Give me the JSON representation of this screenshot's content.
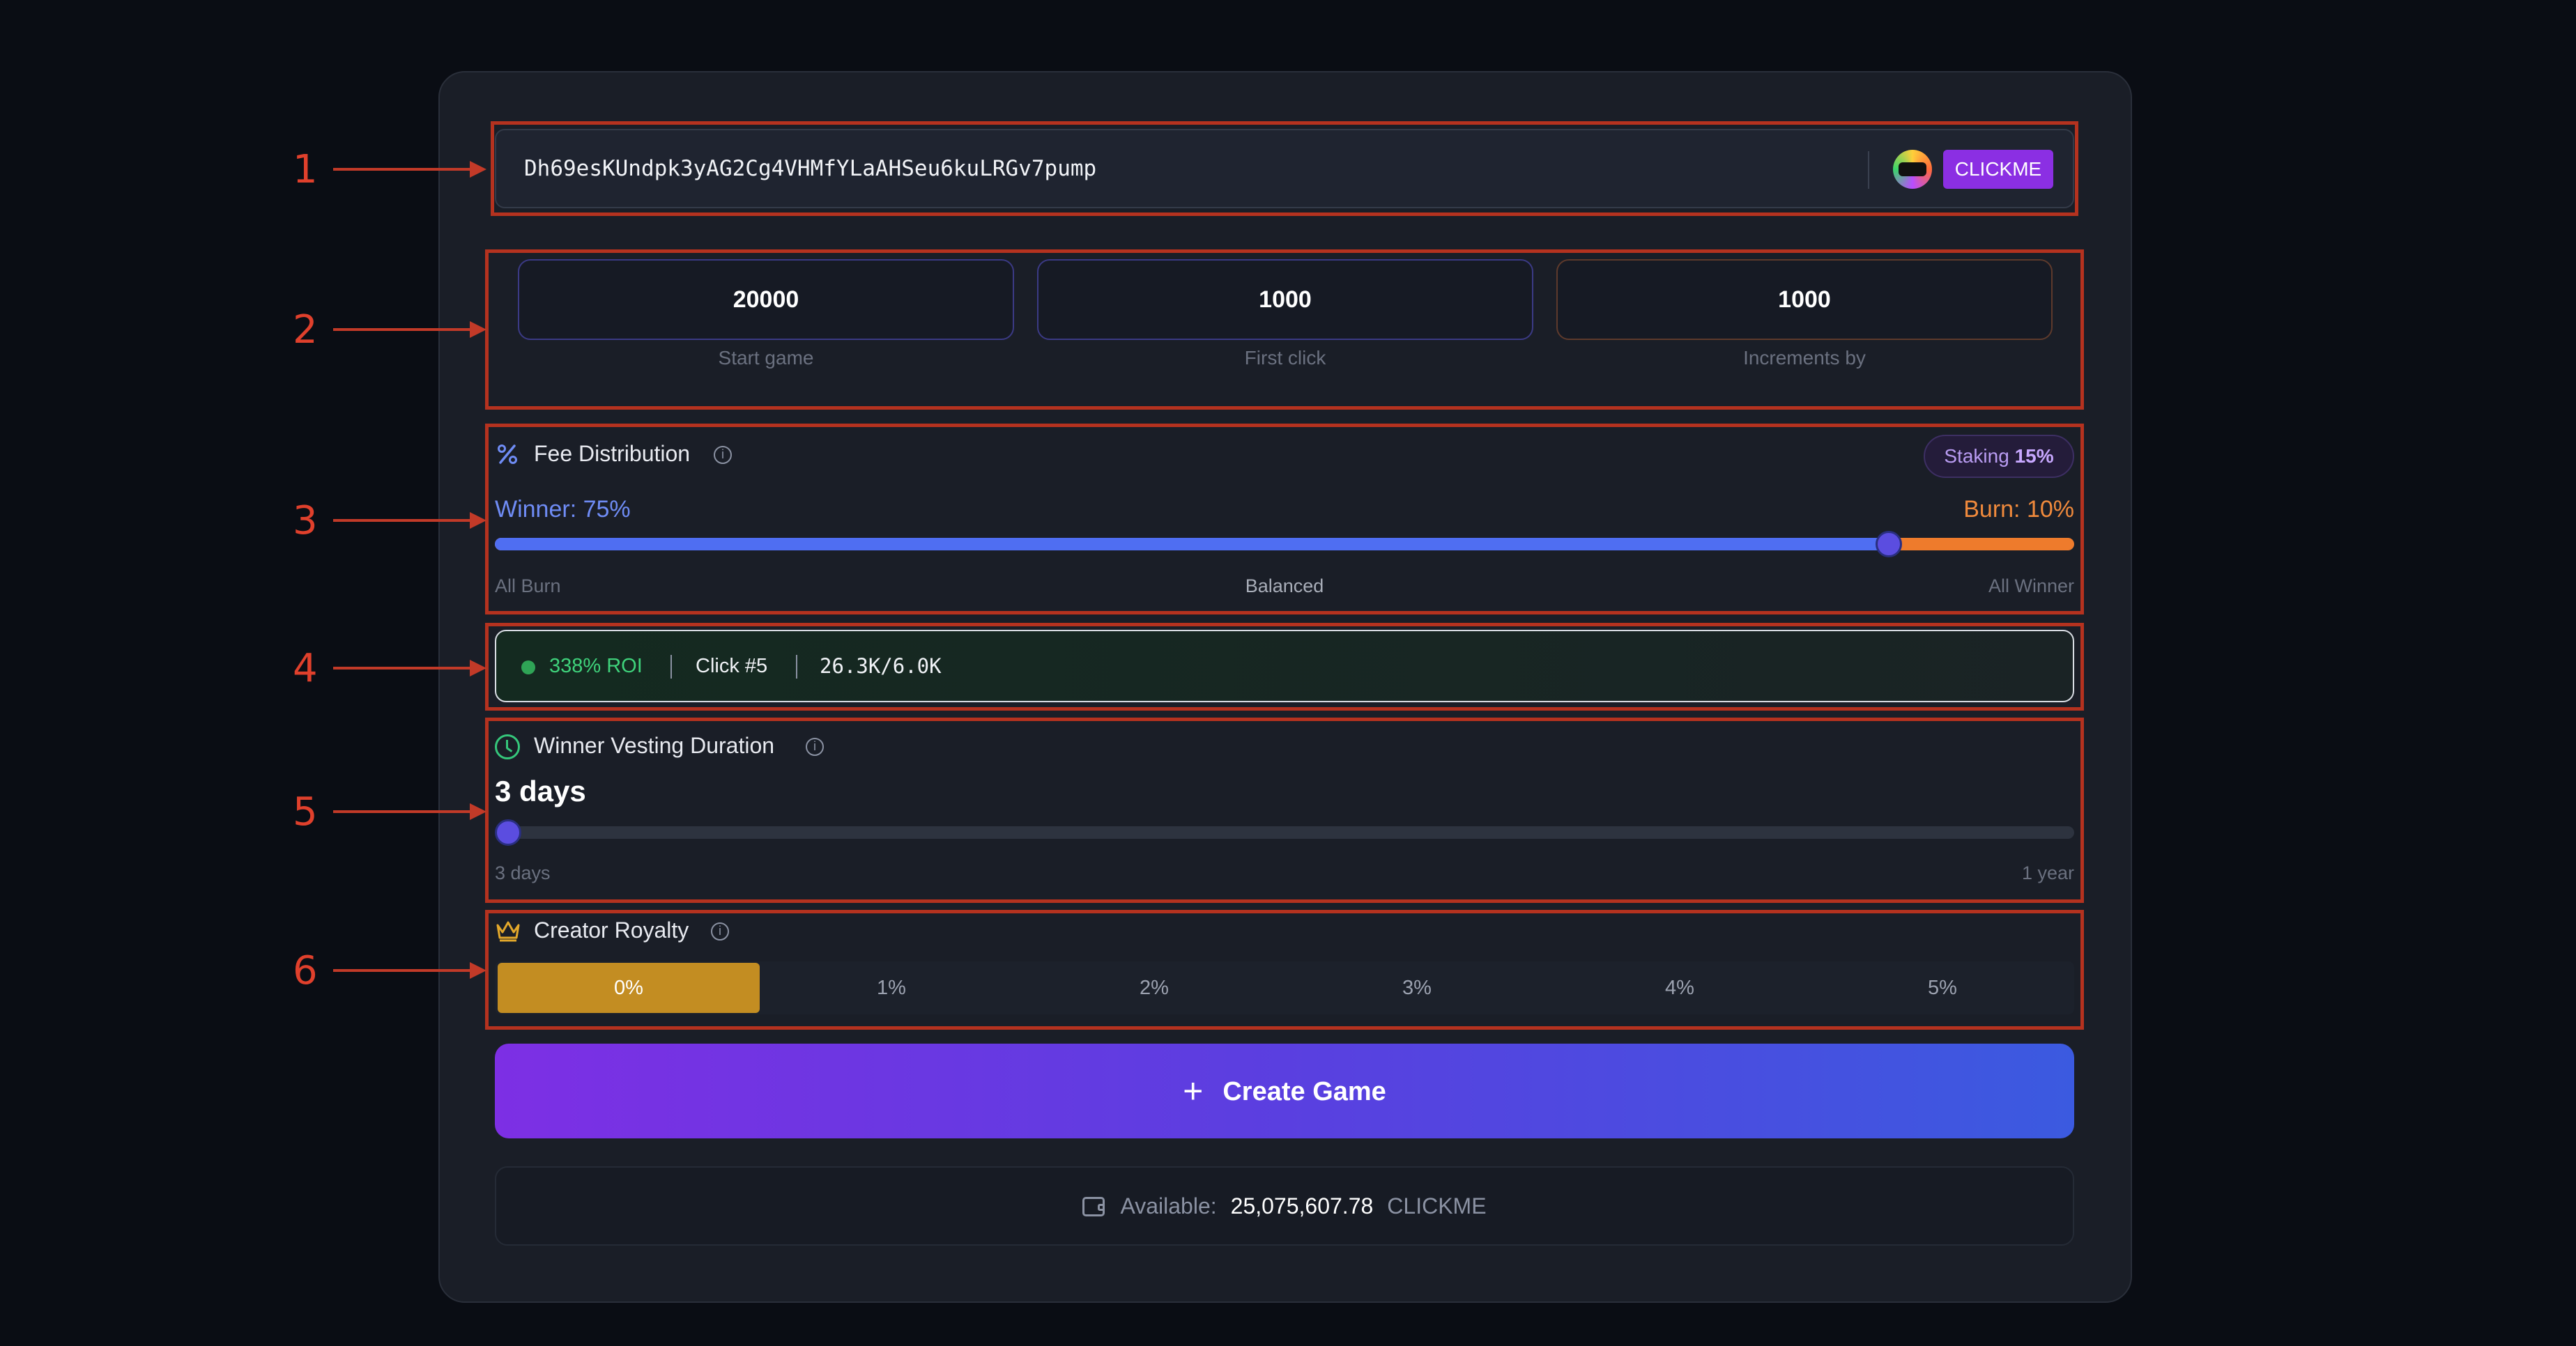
{
  "token": {
    "address": "Dh69esKUndpk3yAG2Cg4VHMfYLaAHSeu6kuLRGv7pump",
    "logo_text": "CLICK ME",
    "symbol": "CLICKME"
  },
  "game_params": [
    {
      "value": "20000",
      "label": "Start game"
    },
    {
      "value": "1000",
      "label": "First click"
    },
    {
      "value": "1000",
      "label": "Increments by"
    }
  ],
  "fee_distribution": {
    "title": "Fee Distribution",
    "staking_label": "Staking",
    "staking_value": "15%",
    "winner_label": "Winner: 75%",
    "burn_label": "Burn: 10%",
    "winner_fraction": 0.8824,
    "scale_left": "All Burn",
    "scale_mid": "Balanced",
    "scale_right": "All Winner"
  },
  "stats": {
    "roi": "338% ROI",
    "click": "Click #5",
    "supply": "26.3K/6.0K"
  },
  "vesting": {
    "title": "Winner Vesting Duration",
    "value": "3 days",
    "min_label": "3 days",
    "max_label": "1 year",
    "position_fraction": 0
  },
  "royalty": {
    "title": "Creator Royalty",
    "options": [
      "0%",
      "1%",
      "2%",
      "3%",
      "4%",
      "5%"
    ],
    "selected": "0%"
  },
  "create_button": "Create Game",
  "balance": {
    "label": "Available:",
    "amount": "25,075,607.78",
    "symbol": "CLICKME"
  },
  "annotations": [
    "1",
    "2",
    "3",
    "4",
    "5",
    "6"
  ],
  "colors": {
    "annotation": "#b5321f",
    "winner": "#4f6ef2",
    "burn": "#ee7b2c",
    "royalty_selected": "#c38d22",
    "roi": "#3fd27b"
  }
}
